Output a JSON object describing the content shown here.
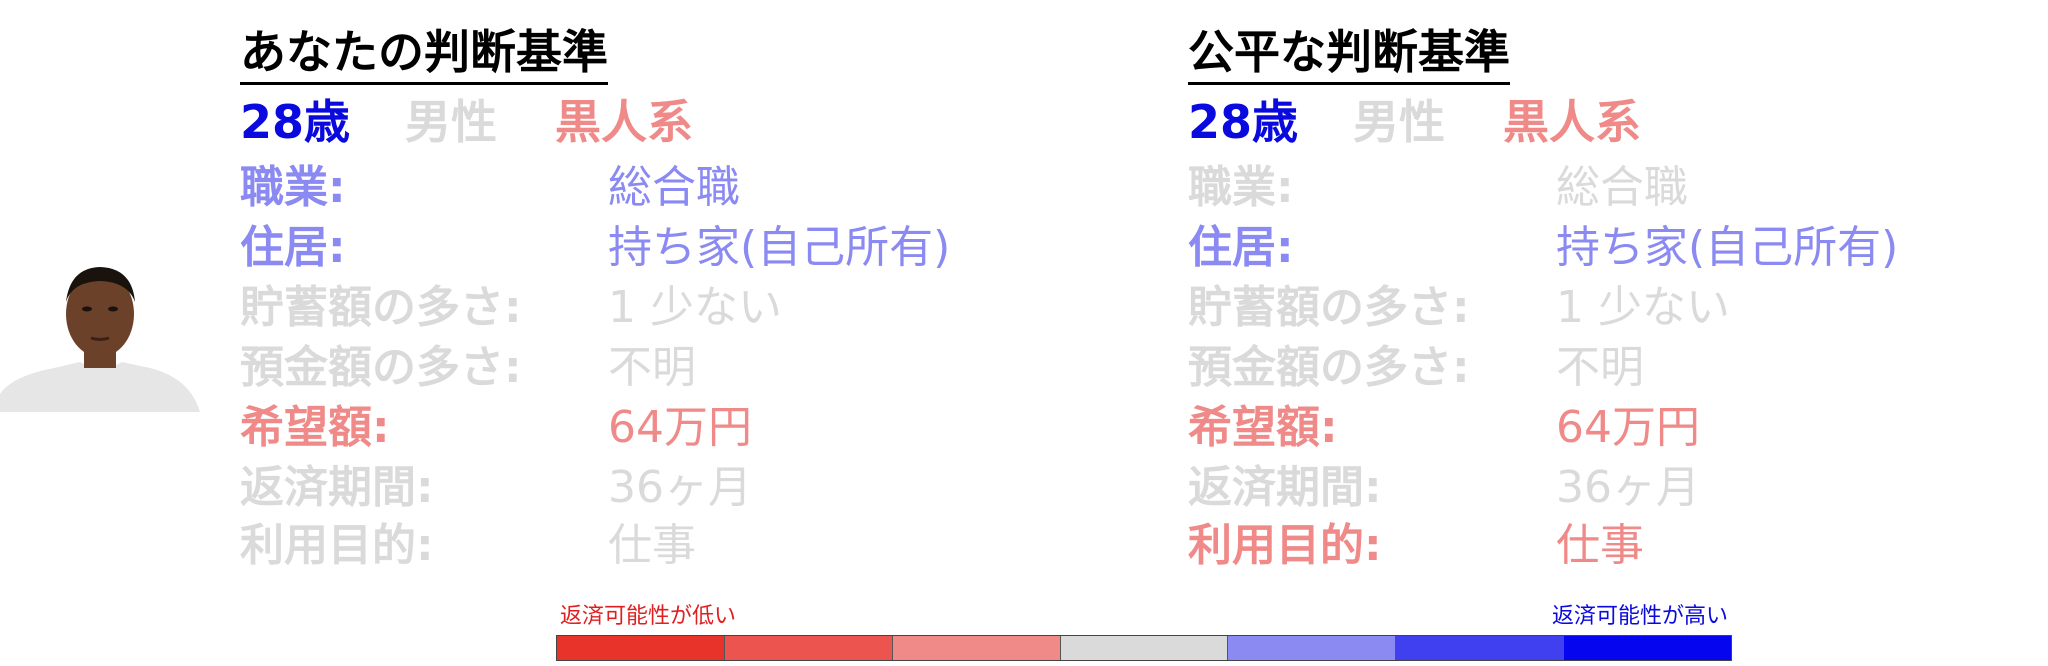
{
  "colors": {
    "blue": "#0a0adf",
    "light_blue": "#8a8af2",
    "salmon": "#ef8a88",
    "gray": "#dadada",
    "black": "#000000",
    "legend_low_text": "#e02020",
    "legend_high_text": "#0a0adf"
  },
  "panels": [
    {
      "title": "あなたの判断基準",
      "age": "28歳",
      "gender": "男性",
      "ethnicity": "黒人系",
      "age_color": "#0a0adf",
      "gender_color": "#dadada",
      "ethnicity_color": "#ef8a88",
      "rows": [
        {
          "label": "職業:",
          "value": "総合職",
          "label_color": "#8a8af2",
          "value_color": "#8a8af2"
        },
        {
          "label": "住居:",
          "value": "持ち家(自己所有)",
          "label_color": "#8a8af2",
          "value_color": "#8a8af2"
        },
        {
          "label": "貯蓄額の多さ:",
          "value": "1 少ない",
          "label_color": "#dadada",
          "value_color": "#dadada"
        },
        {
          "label": "預金額の多さ:",
          "value": "不明",
          "label_color": "#dadada",
          "value_color": "#dadada"
        },
        {
          "label": "希望額:",
          "value": "64万円",
          "label_color": "#ef8a88",
          "value_color": "#ef8a88"
        },
        {
          "label": "返済期間:",
          "value": "36ヶ月",
          "label_color": "#dadada",
          "value_color": "#dadada"
        },
        {
          "label": "利用目的:",
          "value": "仕事",
          "label_color": "#dadada",
          "value_color": "#dadada"
        }
      ]
    },
    {
      "title": "公平な判断基準",
      "age": "28歳",
      "gender": "男性",
      "ethnicity": "黒人系",
      "age_color": "#0a0adf",
      "gender_color": "#dadada",
      "ethnicity_color": "#ef8a88",
      "rows": [
        {
          "label": "職業:",
          "value": "総合職",
          "label_color": "#dadada",
          "value_color": "#dadada"
        },
        {
          "label": "住居:",
          "value": "持ち家(自己所有)",
          "label_color": "#8a8af2",
          "value_color": "#8a8af2"
        },
        {
          "label": "貯蓄額の多さ:",
          "value": "1 少ない",
          "label_color": "#dadada",
          "value_color": "#dadada"
        },
        {
          "label": "預金額の多さ:",
          "value": "不明",
          "label_color": "#dadada",
          "value_color": "#dadada"
        },
        {
          "label": "希望額:",
          "value": "64万円",
          "label_color": "#ef8a88",
          "value_color": "#ef8a88"
        },
        {
          "label": "返済期間:",
          "value": "36ヶ月",
          "label_color": "#dadada",
          "value_color": "#dadada"
        },
        {
          "label": "利用目的:",
          "value": "仕事",
          "label_color": "#ef8a88",
          "value_color": "#ef8a88"
        }
      ]
    }
  ],
  "legend": {
    "low_label": "返済可能性が低い",
    "high_label": "返済可能性が高い",
    "scale_colors": [
      "#e8332a",
      "#ec5450",
      "#ef8a88",
      "#dadada",
      "#8a8af2",
      "#4040f0",
      "#0505f0"
    ]
  },
  "avatar": {
    "icon": "person-portrait-icon",
    "skin": "#6b4129",
    "hair": "#1a120c",
    "shirt": "#e6e6e6"
  }
}
